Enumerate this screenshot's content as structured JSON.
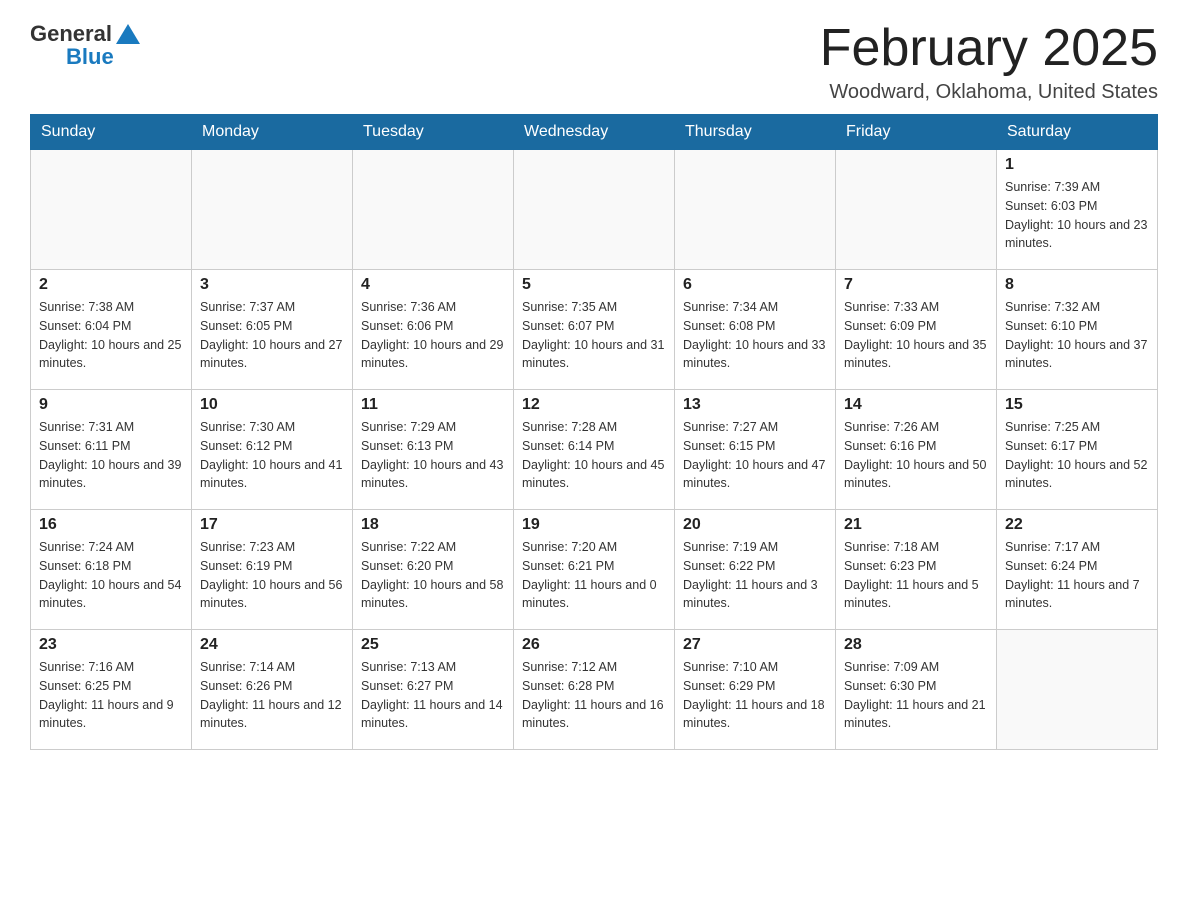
{
  "header": {
    "logo_general": "General",
    "logo_blue": "Blue",
    "title": "February 2025",
    "location": "Woodward, Oklahoma, United States"
  },
  "days_of_week": [
    "Sunday",
    "Monday",
    "Tuesday",
    "Wednesday",
    "Thursday",
    "Friday",
    "Saturday"
  ],
  "weeks": [
    [
      {
        "num": "",
        "sunrise": "",
        "sunset": "",
        "daylight": ""
      },
      {
        "num": "",
        "sunrise": "",
        "sunset": "",
        "daylight": ""
      },
      {
        "num": "",
        "sunrise": "",
        "sunset": "",
        "daylight": ""
      },
      {
        "num": "",
        "sunrise": "",
        "sunset": "",
        "daylight": ""
      },
      {
        "num": "",
        "sunrise": "",
        "sunset": "",
        "daylight": ""
      },
      {
        "num": "",
        "sunrise": "",
        "sunset": "",
        "daylight": ""
      },
      {
        "num": "1",
        "sunrise": "Sunrise: 7:39 AM",
        "sunset": "Sunset: 6:03 PM",
        "daylight": "Daylight: 10 hours and 23 minutes."
      }
    ],
    [
      {
        "num": "2",
        "sunrise": "Sunrise: 7:38 AM",
        "sunset": "Sunset: 6:04 PM",
        "daylight": "Daylight: 10 hours and 25 minutes."
      },
      {
        "num": "3",
        "sunrise": "Sunrise: 7:37 AM",
        "sunset": "Sunset: 6:05 PM",
        "daylight": "Daylight: 10 hours and 27 minutes."
      },
      {
        "num": "4",
        "sunrise": "Sunrise: 7:36 AM",
        "sunset": "Sunset: 6:06 PM",
        "daylight": "Daylight: 10 hours and 29 minutes."
      },
      {
        "num": "5",
        "sunrise": "Sunrise: 7:35 AM",
        "sunset": "Sunset: 6:07 PM",
        "daylight": "Daylight: 10 hours and 31 minutes."
      },
      {
        "num": "6",
        "sunrise": "Sunrise: 7:34 AM",
        "sunset": "Sunset: 6:08 PM",
        "daylight": "Daylight: 10 hours and 33 minutes."
      },
      {
        "num": "7",
        "sunrise": "Sunrise: 7:33 AM",
        "sunset": "Sunset: 6:09 PM",
        "daylight": "Daylight: 10 hours and 35 minutes."
      },
      {
        "num": "8",
        "sunrise": "Sunrise: 7:32 AM",
        "sunset": "Sunset: 6:10 PM",
        "daylight": "Daylight: 10 hours and 37 minutes."
      }
    ],
    [
      {
        "num": "9",
        "sunrise": "Sunrise: 7:31 AM",
        "sunset": "Sunset: 6:11 PM",
        "daylight": "Daylight: 10 hours and 39 minutes."
      },
      {
        "num": "10",
        "sunrise": "Sunrise: 7:30 AM",
        "sunset": "Sunset: 6:12 PM",
        "daylight": "Daylight: 10 hours and 41 minutes."
      },
      {
        "num": "11",
        "sunrise": "Sunrise: 7:29 AM",
        "sunset": "Sunset: 6:13 PM",
        "daylight": "Daylight: 10 hours and 43 minutes."
      },
      {
        "num": "12",
        "sunrise": "Sunrise: 7:28 AM",
        "sunset": "Sunset: 6:14 PM",
        "daylight": "Daylight: 10 hours and 45 minutes."
      },
      {
        "num": "13",
        "sunrise": "Sunrise: 7:27 AM",
        "sunset": "Sunset: 6:15 PM",
        "daylight": "Daylight: 10 hours and 47 minutes."
      },
      {
        "num": "14",
        "sunrise": "Sunrise: 7:26 AM",
        "sunset": "Sunset: 6:16 PM",
        "daylight": "Daylight: 10 hours and 50 minutes."
      },
      {
        "num": "15",
        "sunrise": "Sunrise: 7:25 AM",
        "sunset": "Sunset: 6:17 PM",
        "daylight": "Daylight: 10 hours and 52 minutes."
      }
    ],
    [
      {
        "num": "16",
        "sunrise": "Sunrise: 7:24 AM",
        "sunset": "Sunset: 6:18 PM",
        "daylight": "Daylight: 10 hours and 54 minutes."
      },
      {
        "num": "17",
        "sunrise": "Sunrise: 7:23 AM",
        "sunset": "Sunset: 6:19 PM",
        "daylight": "Daylight: 10 hours and 56 minutes."
      },
      {
        "num": "18",
        "sunrise": "Sunrise: 7:22 AM",
        "sunset": "Sunset: 6:20 PM",
        "daylight": "Daylight: 10 hours and 58 minutes."
      },
      {
        "num": "19",
        "sunrise": "Sunrise: 7:20 AM",
        "sunset": "Sunset: 6:21 PM",
        "daylight": "Daylight: 11 hours and 0 minutes."
      },
      {
        "num": "20",
        "sunrise": "Sunrise: 7:19 AM",
        "sunset": "Sunset: 6:22 PM",
        "daylight": "Daylight: 11 hours and 3 minutes."
      },
      {
        "num": "21",
        "sunrise": "Sunrise: 7:18 AM",
        "sunset": "Sunset: 6:23 PM",
        "daylight": "Daylight: 11 hours and 5 minutes."
      },
      {
        "num": "22",
        "sunrise": "Sunrise: 7:17 AM",
        "sunset": "Sunset: 6:24 PM",
        "daylight": "Daylight: 11 hours and 7 minutes."
      }
    ],
    [
      {
        "num": "23",
        "sunrise": "Sunrise: 7:16 AM",
        "sunset": "Sunset: 6:25 PM",
        "daylight": "Daylight: 11 hours and 9 minutes."
      },
      {
        "num": "24",
        "sunrise": "Sunrise: 7:14 AM",
        "sunset": "Sunset: 6:26 PM",
        "daylight": "Daylight: 11 hours and 12 minutes."
      },
      {
        "num": "25",
        "sunrise": "Sunrise: 7:13 AM",
        "sunset": "Sunset: 6:27 PM",
        "daylight": "Daylight: 11 hours and 14 minutes."
      },
      {
        "num": "26",
        "sunrise": "Sunrise: 7:12 AM",
        "sunset": "Sunset: 6:28 PM",
        "daylight": "Daylight: 11 hours and 16 minutes."
      },
      {
        "num": "27",
        "sunrise": "Sunrise: 7:10 AM",
        "sunset": "Sunset: 6:29 PM",
        "daylight": "Daylight: 11 hours and 18 minutes."
      },
      {
        "num": "28",
        "sunrise": "Sunrise: 7:09 AM",
        "sunset": "Sunset: 6:30 PM",
        "daylight": "Daylight: 11 hours and 21 minutes."
      },
      {
        "num": "",
        "sunrise": "",
        "sunset": "",
        "daylight": ""
      }
    ]
  ]
}
